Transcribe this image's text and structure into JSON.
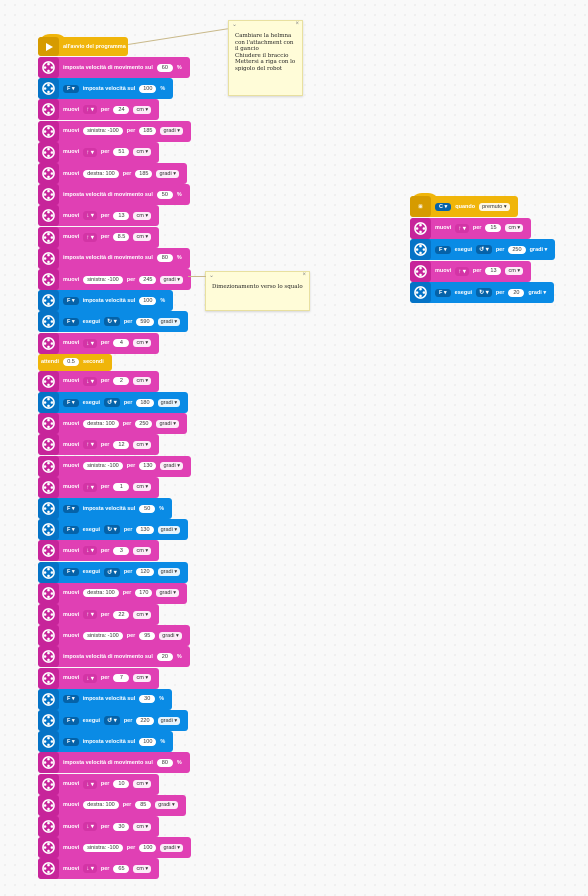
{
  "start_label": "all'avvio del programma",
  "notes": [
    {
      "text": "Cambiare la helmna con l'attachment con il gancio\nChiudere il braccio\nMettersi a riga con lo spigolo del robot"
    },
    {
      "text": "Dimezionamento verso lo squalo"
    }
  ],
  "main_script": [
    {
      "type": "move",
      "parts": [
        "imposta velocità di movimento sul",
        {
          "o": "60"
        },
        "%"
      ]
    },
    {
      "type": "motor",
      "parts": [
        {
          "p": "F ▾"
        },
        "imposta velocità sul",
        {
          "o": "100"
        },
        "%"
      ]
    },
    {
      "type": "move",
      "parts": [
        "muovi",
        {
          "dir": "↑ ▾"
        },
        "per",
        {
          "o": "24"
        },
        {
          "d": "cm ▾"
        }
      ]
    },
    {
      "type": "move",
      "parts": [
        "muovi",
        {
          "o": "sinistra: -100"
        },
        "per",
        {
          "o": "185"
        },
        {
          "d": "gradi ▾"
        }
      ]
    },
    {
      "type": "move",
      "parts": [
        "muovi",
        {
          "dir": "↑ ▾"
        },
        "per",
        {
          "o": "51"
        },
        {
          "d": "cm ▾"
        }
      ]
    },
    {
      "type": "move",
      "parts": [
        "muovi",
        {
          "o": "destra: 100"
        },
        "per",
        {
          "o": "185"
        },
        {
          "d": "gradi ▾"
        }
      ]
    },
    {
      "type": "move",
      "parts": [
        "imposta velocità di movimento sul",
        {
          "o": "50"
        },
        "%"
      ]
    },
    {
      "type": "move",
      "parts": [
        "muovi",
        {
          "dir": "↓ ▾"
        },
        "per",
        {
          "o": "13"
        },
        {
          "d": "cm ▾"
        }
      ]
    },
    {
      "type": "move",
      "parts": [
        "muovi",
        {
          "dir": "↑ ▾"
        },
        "per",
        {
          "o": "8.5"
        },
        {
          "d": "cm ▾"
        }
      ]
    },
    {
      "type": "move",
      "parts": [
        "imposta velocità di movimento sul",
        {
          "o": "80"
        },
        "%"
      ]
    },
    {
      "type": "move",
      "parts": [
        "muovi",
        {
          "o": "sinistra: -100"
        },
        "per",
        {
          "o": "245"
        },
        {
          "d": "gradi ▾"
        }
      ]
    },
    {
      "type": "motor",
      "parts": [
        {
          "p": "F ▾"
        },
        "imposta velocità sul",
        {
          "o": "100"
        },
        "%"
      ]
    },
    {
      "type": "motor",
      "parts": [
        {
          "p": "F ▾"
        },
        "esegui",
        {
          "dir": "↻ ▾"
        },
        "per",
        {
          "o": "590"
        },
        {
          "d": "gradi ▾"
        }
      ]
    },
    {
      "type": "move",
      "parts": [
        "muovi",
        {
          "dir": "↓ ▾"
        },
        "per",
        {
          "o": "4"
        },
        {
          "d": "cm ▾"
        }
      ]
    },
    {
      "type": "control",
      "parts": [
        "attendi",
        {
          "o": "0.5"
        },
        "secondi"
      ]
    },
    {
      "type": "move",
      "parts": [
        "muovi",
        {
          "dir": "↓ ▾"
        },
        "per",
        {
          "o": "2"
        },
        {
          "d": "cm ▾"
        }
      ]
    },
    {
      "type": "motor",
      "parts": [
        {
          "p": "F ▾"
        },
        "esegui",
        {
          "dir": "↺ ▾"
        },
        "per",
        {
          "o": "180"
        },
        {
          "d": "gradi ▾"
        }
      ]
    },
    {
      "type": "move",
      "parts": [
        "muovi",
        {
          "o": "destra: 100"
        },
        "per",
        {
          "o": "250"
        },
        {
          "d": "gradi ▾"
        }
      ]
    },
    {
      "type": "move",
      "parts": [
        "muovi",
        {
          "dir": "↑ ▾"
        },
        "per",
        {
          "o": "12"
        },
        {
          "d": "cm ▾"
        }
      ]
    },
    {
      "type": "move",
      "parts": [
        "muovi",
        {
          "o": "sinistra: -100"
        },
        "per",
        {
          "o": "130"
        },
        {
          "d": "gradi ▾"
        }
      ]
    },
    {
      "type": "move",
      "parts": [
        "muovi",
        {
          "dir": "↑ ▾"
        },
        "per",
        {
          "o": "1"
        },
        {
          "d": "cm ▾"
        }
      ]
    },
    {
      "type": "motor",
      "parts": [
        {
          "p": "F ▾"
        },
        "imposta velocità sul",
        {
          "o": "50"
        },
        "%"
      ]
    },
    {
      "type": "motor",
      "parts": [
        {
          "p": "F ▾"
        },
        "esegui",
        {
          "dir": "↻ ▾"
        },
        "per",
        {
          "o": "130"
        },
        {
          "d": "gradi ▾"
        }
      ]
    },
    {
      "type": "move",
      "parts": [
        "muovi",
        {
          "dir": "↓ ▾"
        },
        "per",
        {
          "o": "3"
        },
        {
          "d": "cm ▾"
        }
      ]
    },
    {
      "type": "motor",
      "parts": [
        {
          "p": "F ▾"
        },
        "esegui",
        {
          "dir": "↺ ▾"
        },
        "per",
        {
          "o": "120"
        },
        {
          "d": "gradi ▾"
        }
      ]
    },
    {
      "type": "move",
      "parts": [
        "muovi",
        {
          "o": "destra: 100"
        },
        "per",
        {
          "o": "170"
        },
        {
          "d": "gradi ▾"
        }
      ]
    },
    {
      "type": "move",
      "parts": [
        "muovi",
        {
          "dir": "↑ ▾"
        },
        "per",
        {
          "o": "22"
        },
        {
          "d": "cm ▾"
        }
      ]
    },
    {
      "type": "move",
      "parts": [
        "muovi",
        {
          "o": "sinistra: -100"
        },
        "per",
        {
          "o": "95"
        },
        {
          "d": "gradi ▾"
        }
      ]
    },
    {
      "type": "move",
      "parts": [
        "imposta velocità di movimento sul",
        {
          "o": "20"
        },
        "%"
      ]
    },
    {
      "type": "move",
      "parts": [
        "muovi",
        {
          "dir": "↓ ▾"
        },
        "per",
        {
          "o": "7"
        },
        {
          "d": "cm ▾"
        }
      ]
    },
    {
      "type": "motor",
      "parts": [
        {
          "p": "F ▾"
        },
        "imposta velocità sul",
        {
          "o": "30"
        },
        "%"
      ]
    },
    {
      "type": "motor",
      "parts": [
        {
          "p": "F ▾"
        },
        "esegui",
        {
          "dir": "↺ ▾"
        },
        "per",
        {
          "o": "220"
        },
        {
          "d": "gradi ▾"
        }
      ]
    },
    {
      "type": "motor",
      "parts": [
        {
          "p": "F ▾"
        },
        "imposta velocità sul",
        {
          "o": "100"
        },
        "%"
      ]
    },
    {
      "type": "move",
      "parts": [
        "imposta velocità di movimento sul",
        {
          "o": "80"
        },
        "%"
      ]
    },
    {
      "type": "move",
      "parts": [
        "muovi",
        {
          "dir": "↓ ▾"
        },
        "per",
        {
          "o": "10"
        },
        {
          "d": "cm ▾"
        }
      ]
    },
    {
      "type": "move",
      "parts": [
        "muovi",
        {
          "o": "destra: 100"
        },
        "per",
        {
          "o": "85"
        },
        {
          "d": "gradi ▾"
        }
      ]
    },
    {
      "type": "move",
      "parts": [
        "muovi",
        {
          "dir": "↓ ▾"
        },
        "per",
        {
          "o": "30"
        },
        {
          "d": "cm ▾"
        }
      ]
    },
    {
      "type": "move",
      "parts": [
        "muovi",
        {
          "o": "sinistra: -100"
        },
        "per",
        {
          "o": "100"
        },
        {
          "d": "gradi ▾"
        }
      ]
    },
    {
      "type": "move",
      "parts": [
        "muovi",
        {
          "dir": "↓ ▾"
        },
        "per",
        {
          "o": "65"
        },
        {
          "d": "cm ▾"
        }
      ]
    }
  ],
  "second_script": [
    {
      "type": "event",
      "parts": [
        {
          "p": "C ▾"
        },
        "quando",
        {
          "d": "premuto ▾"
        }
      ]
    },
    {
      "type": "move",
      "parts": [
        "muovi",
        {
          "dir": "↑ ▾"
        },
        "per",
        {
          "o": "15"
        },
        {
          "d": "cm ▾"
        }
      ]
    },
    {
      "type": "motor",
      "parts": [
        {
          "p": "F ▾"
        },
        "esegui",
        {
          "dir": "↺ ▾"
        },
        "per",
        {
          "o": "250"
        },
        "gradi ▾"
      ]
    },
    {
      "type": "move",
      "parts": [
        "muovi",
        {
          "dir": "↑ ▾"
        },
        "per",
        {
          "o": "13"
        },
        {
          "d": "cm ▾"
        }
      ]
    },
    {
      "type": "motor",
      "parts": [
        {
          "p": "F ▾"
        },
        "esegui",
        {
          "dir": "↻ ▾"
        },
        "per",
        {
          "o": "20"
        },
        "gradi ▾"
      ]
    }
  ]
}
